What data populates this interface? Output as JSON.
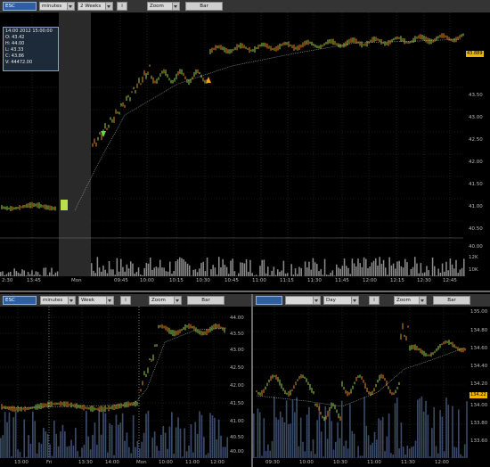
{
  "top": {
    "symbol": "ESC",
    "interval": "minutes",
    "range": "2 Weeks",
    "info_btn": "i",
    "zoom": "Zoom",
    "style": "Bar",
    "info": [
      "14:00 2012 15:00:00",
      "O: 43.42",
      "H: 44.00",
      "L: 43.33",
      "C: 43.86",
      "V: 44472.00"
    ],
    "y_labels": [
      "43.50",
      "43.00",
      "42.50",
      "42.00",
      "41.50",
      "41.00",
      "40.50",
      "40.00"
    ],
    "last_price": "43.889",
    "vol_labels": [
      "12K",
      "10K"
    ],
    "x_labels": [
      "2:30",
      "13:45",
      "Mon",
      "09:45",
      "10:00",
      "10:15",
      "10:30",
      "10:45",
      "11:00",
      "11:15",
      "11:30",
      "11:45",
      "12:00",
      "12:15",
      "12:30",
      "12:45"
    ]
  },
  "left": {
    "symbol": "ESC",
    "interval": "minutes",
    "range": "Week",
    "info_btn": "i",
    "zoom": "Zoom",
    "style": "Bar",
    "y_labels": [
      "44.00",
      "43.50",
      "43.00",
      "42.50",
      "42.00",
      "41.50",
      "41.00",
      "40.50",
      "40.00"
    ],
    "x_labels": [
      "13:00",
      "Fri",
      "13:30",
      "14:00",
      "Mon",
      "10:00",
      "11:00",
      "12:00"
    ]
  },
  "right": {
    "symbol": "",
    "interval": "",
    "range": "Day",
    "info_btn": "i",
    "zoom": "Zoom",
    "style": "Bar",
    "y_labels": [
      "135.00",
      "134.80",
      "134.60",
      "134.40",
      "134.20",
      "134.00",
      "133.80",
      "133.60"
    ],
    "last_price": "134.22",
    "x_labels": [
      "09:30",
      "10:00",
      "10:30",
      "11:00",
      "11:30",
      "12:00"
    ]
  }
}
